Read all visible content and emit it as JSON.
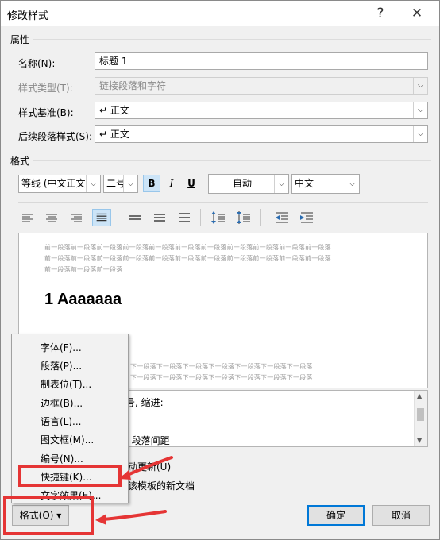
{
  "dialog": {
    "title": "修改样式",
    "help_glyph": "?",
    "close_glyph": "✕"
  },
  "properties": {
    "section_label": "属性",
    "name_label": "名称(N):",
    "name_value": "标题 1",
    "style_type_label": "样式类型(T):",
    "style_type_value": "链接段落和字符",
    "based_on_label": "样式基准(B):",
    "based_on_value": "↵ 正文",
    "following_label": "后续段落样式(S):",
    "following_value": "↵ 正文"
  },
  "format": {
    "section_label": "格式",
    "font_value": "等线 (中文正文)",
    "size_value": "二号",
    "bold": "B",
    "italic": "I",
    "underline": "U",
    "color_value": "自动",
    "language_value": "中文"
  },
  "preview": {
    "prev_line_1": "前一段落前一段落前一段落前一段落前一段落前一段落前一段落前一段落前一段落前一段落前一段落",
    "prev_line_2": "前一段落前一段落前一段落前一段落前一段落前一段落前一段落前一段落前一段落前一段落前一段落",
    "prev_line_3": "前一段落前一段落前一段落",
    "heading_text": "1  Aaaaaaa",
    "next_line_1": "下一段落下一段落下一段落下一段落下一段落下一段落下一段落",
    "next_line_2": "下一段落下一段落下一段落下一段落下一段落下一段落下一段落"
  },
  "description": {
    "line_1": "二号, 缩进:",
    "line_2": "行, 段落间距"
  },
  "options": {
    "auto_update_partial": "动更新(U)",
    "new_docs_partial": "该模板的新文档"
  },
  "menu": {
    "items": [
      "字体(F)...",
      "段落(P)...",
      "制表位(T)...",
      "边框(B)...",
      "语言(L)...",
      "图文框(M)...",
      "编号(N)...",
      "快捷键(K)...",
      "文字效果(E)..."
    ]
  },
  "buttons": {
    "format_label": "格式(O)",
    "format_arrow": "▾",
    "ok_label": "确定",
    "cancel_label": "取消"
  },
  "colors": {
    "annotation_red": "#e53535",
    "selected_blue": "#cce4f7"
  }
}
